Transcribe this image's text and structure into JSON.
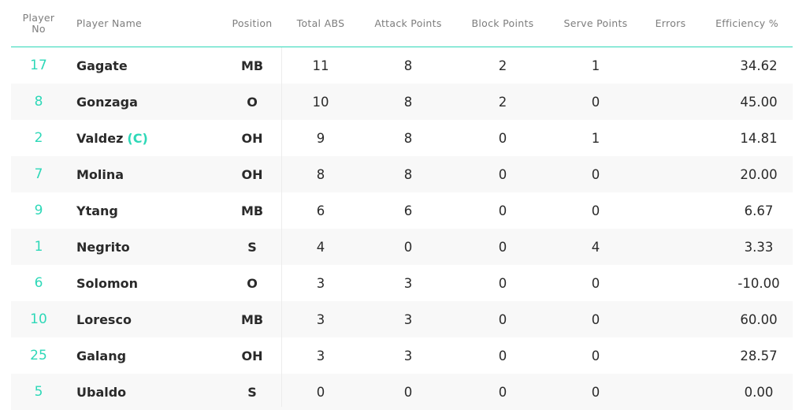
{
  "headers": {
    "no": "Player No",
    "no_line1": "Player",
    "no_line2": "No",
    "name": "Player Name",
    "position": "Position",
    "total_abs": "Total ABS",
    "attack": "Attack Points",
    "block": "Block Points",
    "serve": "Serve Points",
    "errors": "Errors",
    "efficiency": "Efficiency %"
  },
  "rows": [
    {
      "no": "17",
      "name": "Gagate",
      "captain": "",
      "pos": "MB",
      "abs": "11",
      "att": "8",
      "blk": "2",
      "srv": "1",
      "err": "",
      "eff": "34.62"
    },
    {
      "no": "8",
      "name": "Gonzaga",
      "captain": "",
      "pos": "O",
      "abs": "10",
      "att": "8",
      "blk": "2",
      "srv": "0",
      "err": "",
      "eff": "45.00"
    },
    {
      "no": "2",
      "name": "Valdez",
      "captain": "(C)",
      "pos": "OH",
      "abs": "9",
      "att": "8",
      "blk": "0",
      "srv": "1",
      "err": "",
      "eff": "14.81"
    },
    {
      "no": "7",
      "name": "Molina",
      "captain": "",
      "pos": "OH",
      "abs": "8",
      "att": "8",
      "blk": "0",
      "srv": "0",
      "err": "",
      "eff": "20.00"
    },
    {
      "no": "9",
      "name": "Ytang",
      "captain": "",
      "pos": "MB",
      "abs": "6",
      "att": "6",
      "blk": "0",
      "srv": "0",
      "err": "",
      "eff": "6.67"
    },
    {
      "no": "1",
      "name": "Negrito",
      "captain": "",
      "pos": "S",
      "abs": "4",
      "att": "0",
      "blk": "0",
      "srv": "4",
      "err": "",
      "eff": "3.33"
    },
    {
      "no": "6",
      "name": "Solomon",
      "captain": "",
      "pos": "O",
      "abs": "3",
      "att": "3",
      "blk": "0",
      "srv": "0",
      "err": "",
      "eff": "-10.00"
    },
    {
      "no": "10",
      "name": "Loresco",
      "captain": "",
      "pos": "MB",
      "abs": "3",
      "att": "3",
      "blk": "0",
      "srv": "0",
      "err": "",
      "eff": "60.00"
    },
    {
      "no": "25",
      "name": "Galang",
      "captain": "",
      "pos": "OH",
      "abs": "3",
      "att": "3",
      "blk": "0",
      "srv": "0",
      "err": "",
      "eff": "28.57"
    },
    {
      "no": "5",
      "name": "Ubaldo",
      "captain": "",
      "pos": "S",
      "abs": "0",
      "att": "0",
      "blk": "0",
      "srv": "0",
      "err": "",
      "eff": "0.00"
    }
  ],
  "colors": {
    "accent": "#2ed8b8",
    "header_text": "#7d7d7d",
    "row_alt": "#f8f8f8",
    "body_text": "#2a2a2a"
  }
}
